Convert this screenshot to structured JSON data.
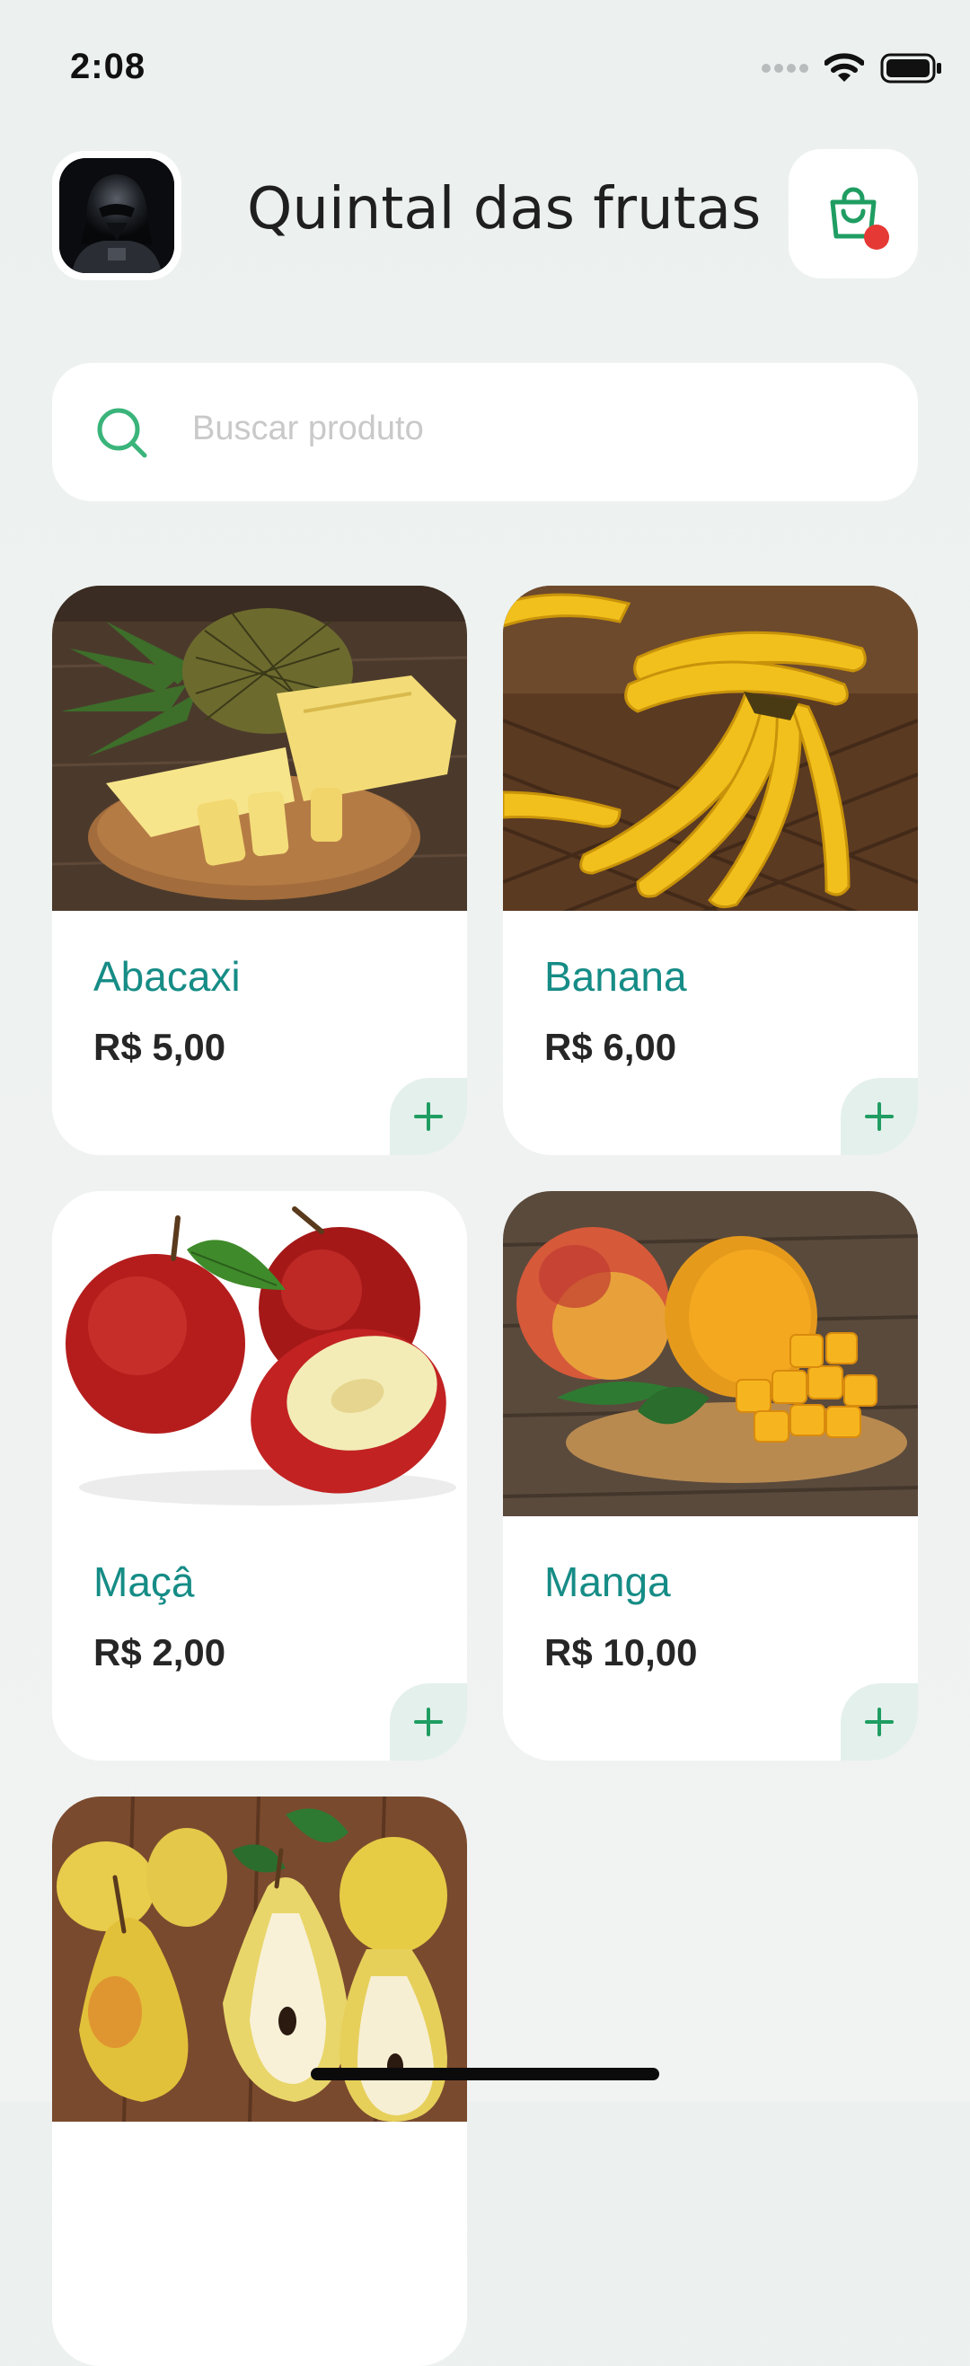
{
  "status_bar": {
    "time": "2:08",
    "icons": [
      "signal-dots-icon",
      "wifi-icon",
      "battery-icon"
    ]
  },
  "header": {
    "title": "Quintal das frutas",
    "avatar": "user-avatar",
    "cart_icon": "shopping-bag-icon",
    "cart_badge_color": "#e53935"
  },
  "search": {
    "placeholder": "Buscar produto",
    "icon": "search-icon"
  },
  "colors": {
    "accent": "#168c86",
    "search_icon": "#3ab47a",
    "add_button_bg": "#e4f0ec"
  },
  "products": [
    {
      "name": "Abacaxi",
      "price": "R$ 5,00",
      "image": "pineapple"
    },
    {
      "name": "Banana",
      "price": "R$ 6,00",
      "image": "banana"
    },
    {
      "name": "Maçâ",
      "price": "R$ 2,00",
      "image": "apple"
    },
    {
      "name": "Manga",
      "price": "R$ 10,00",
      "image": "mango"
    },
    {
      "name": "",
      "price": "",
      "image": "pear"
    }
  ]
}
